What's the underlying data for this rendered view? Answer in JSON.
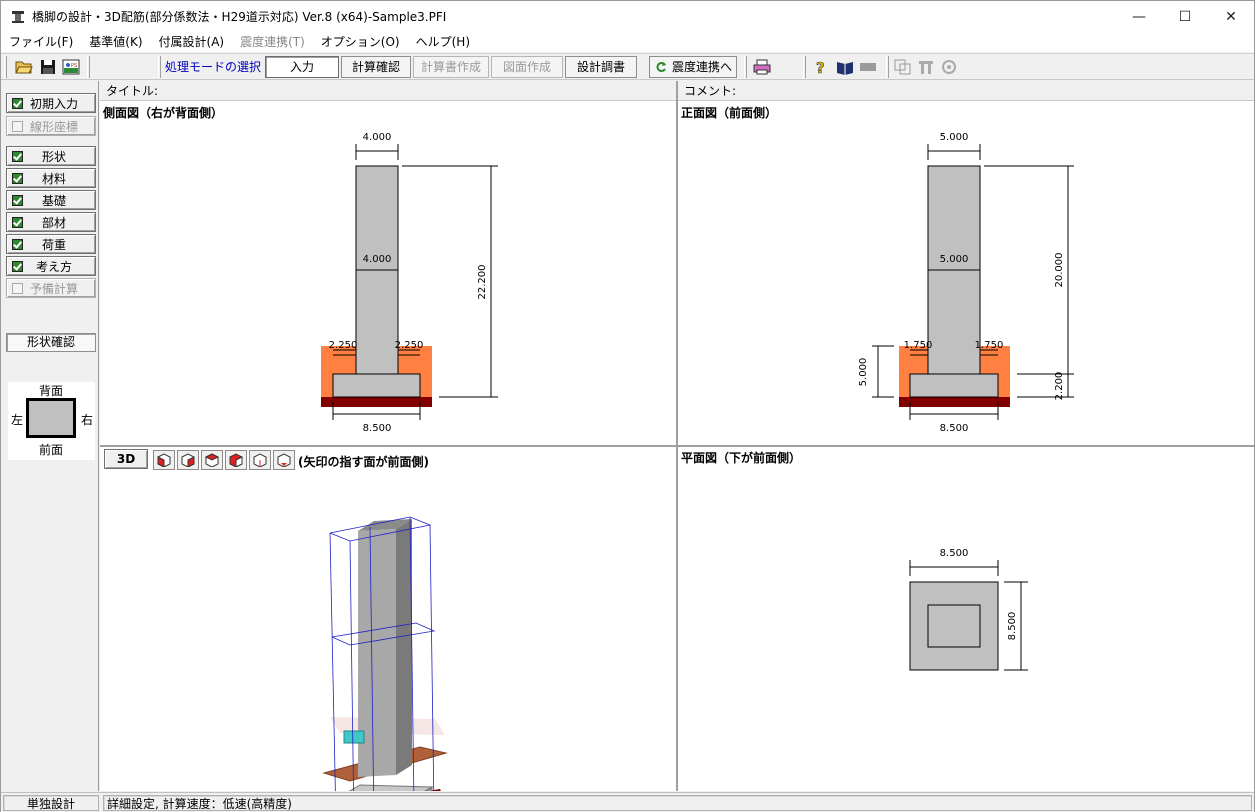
{
  "window": {
    "title": "橋脚の設計・3D配筋(部分係数法・H29道示対応) Ver.8 (x64)-Sample3.PFI",
    "minimize": "—",
    "maximize": "☐",
    "close": "✕"
  },
  "menu": [
    {
      "label": "ファイル(F)",
      "disabled": false
    },
    {
      "label": "基準値(K)",
      "disabled": false
    },
    {
      "label": "付属設計(A)",
      "disabled": false
    },
    {
      "label": "震度連携(T)",
      "disabled": true
    },
    {
      "label": "オプション(O)",
      "disabled": false
    },
    {
      "label": "ヘルプ(H)",
      "disabled": false
    }
  ],
  "toolbar": {
    "mode_label": "処理モードの選択",
    "input": "入力",
    "calc_check": "計算確認",
    "calc_report": "計算書作成",
    "drawing": "図面作成",
    "design_report": "設計調書",
    "seismic_link": "震度連携へ",
    "icons": [
      "open-folder-icon",
      "save-icon",
      "export-icon",
      "print-icon",
      "help-icon",
      "book-icon",
      "bar-icon",
      "copy-icon",
      "link-icon",
      "settings-icon"
    ]
  },
  "left_panel": {
    "items": [
      {
        "label": "初期入力",
        "checked": true,
        "disabled": false
      },
      {
        "label": "線形座標",
        "checked": false,
        "disabled": true
      },
      {
        "label": "形状",
        "checked": true,
        "disabled": false
      },
      {
        "label": "材料",
        "checked": true,
        "disabled": false
      },
      {
        "label": "基礎",
        "checked": true,
        "disabled": false
      },
      {
        "label": "部材",
        "checked": true,
        "disabled": false
      },
      {
        "label": "荷重",
        "checked": true,
        "disabled": false
      },
      {
        "label": "考え方",
        "checked": true,
        "disabled": false
      },
      {
        "label": "予備計算",
        "checked": false,
        "disabled": true
      }
    ],
    "shape_check": "形状確認",
    "orientation": {
      "top": "背面",
      "left": "左",
      "right": "右",
      "bottom": "前面"
    }
  },
  "headers": {
    "title_label": "タイトル:",
    "comment_label": "コメント:"
  },
  "side_view": {
    "title": "側面図（右が背面側）",
    "dims": {
      "top_width": "4.000",
      "mid_width": "4.000",
      "left_offset": "2.250",
      "right_offset": "2.250",
      "height": "22.200",
      "footing_width": "8.500"
    }
  },
  "front_view": {
    "title": "正面図（前面側）",
    "dims": {
      "top_width": "5.000",
      "mid_width": "5.000",
      "left_offset": "1.750",
      "right_offset": "1.750",
      "height": "20.000",
      "left_height": "5.000",
      "footing_height": "2.200",
      "footing_width": "8.500"
    }
  },
  "view_3d": {
    "button": "3D",
    "caption": "(矢印の指す面が前面側)",
    "cube_buttons": [
      "view-front-cube-icon",
      "view-right-cube-icon",
      "view-back-cube-icon",
      "view-left-cube-icon",
      "view-top-cube-icon",
      "view-bottom-cube-icon"
    ]
  },
  "plan_view": {
    "title": "平面図（下が前面側）",
    "dims": {
      "width": "8.500",
      "depth": "8.500"
    }
  },
  "status": {
    "mode": "単独設計",
    "message": "詳細設定, 計算速度：低速(高精度)"
  },
  "colors": {
    "concrete": "#c0c0c0",
    "soil": "#ff8040",
    "base": "#800000",
    "accent_text": "#0000c0",
    "check_green": "#2c8c2c"
  }
}
